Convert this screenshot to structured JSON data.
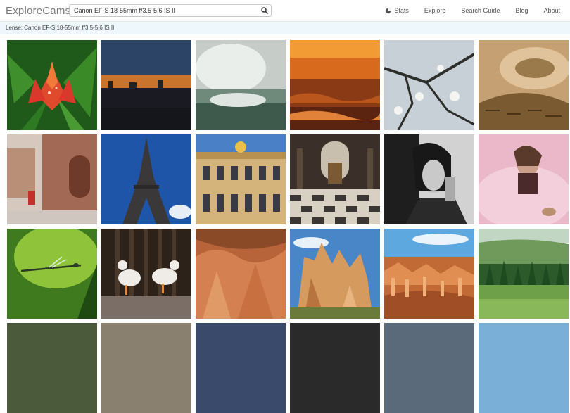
{
  "header": {
    "logo": "ExploreCams",
    "search_value": "Canon EF-S 18-55mm f/3.5-5.6 IS II",
    "nav": [
      {
        "label": "Stats",
        "icon": "pie-chart-icon"
      },
      {
        "label": "Explore"
      },
      {
        "label": "Search Guide"
      },
      {
        "label": "Blog"
      },
      {
        "label": "About"
      }
    ]
  },
  "lense_label": "Lense: Canon EF-S 18-55mm f/3.5-5.6 IS II",
  "photos": [
    {
      "subject": "red lily flower with dew drops",
      "colors": [
        "#2a7a22",
        "#e2462c"
      ]
    },
    {
      "subject": "city skyline at dusk over water",
      "colors": [
        "#2f4a6b",
        "#d1782e"
      ]
    },
    {
      "subject": "Niagara falls mist",
      "colors": [
        "#c7d0c9",
        "#5b7a6a"
      ]
    },
    {
      "subject": "orange sunset over ocean waves",
      "colors": [
        "#e8892b",
        "#6b2e12"
      ]
    },
    {
      "subject": "blossom branches against sky",
      "colors": [
        "#c9d3d8",
        "#343834"
      ]
    },
    {
      "subject": "crocodile leather close-up",
      "colors": [
        "#b99560",
        "#5b4424"
      ]
    },
    {
      "subject": "brick street with red postbox",
      "colors": [
        "#b18f7c",
        "#c23a2a"
      ]
    },
    {
      "subject": "Eiffel tower against blue sky",
      "colors": [
        "#1d4fa3",
        "#3b3a3a"
      ]
    },
    {
      "subject": "Palace of Versailles facade",
      "colors": [
        "#4d82c8",
        "#d6b77a"
      ]
    },
    {
      "subject": "church interior with checker floor",
      "colors": [
        "#3c332b",
        "#d9d2c4"
      ]
    },
    {
      "subject": "black and white portrait of woman",
      "colors": [
        "#cfcfcf",
        "#252525"
      ]
    },
    {
      "subject": "woman in pink tulle dress",
      "colors": [
        "#e9b6c8",
        "#6a3a3e"
      ]
    },
    {
      "subject": "damselfly on green stem",
      "colors": [
        "#8ec23a",
        "#1d4a12"
      ]
    },
    {
      "subject": "two white ducks by wooden fence",
      "colors": [
        "#3e2e22",
        "#e9e4df"
      ]
    },
    {
      "subject": "orange hoodoo rock canyon",
      "colors": [
        "#c56b3a",
        "#7a3e1f"
      ]
    },
    {
      "subject": "hoodoo spires under blue sky",
      "colors": [
        "#4a86c6",
        "#d1955a"
      ]
    },
    {
      "subject": "Bryce canyon amphitheater",
      "colors": [
        "#5ea7e0",
        "#c46a35"
      ]
    },
    {
      "subject": "green hills with trees",
      "colors": [
        "#5d8a4c",
        "#2e5a2a"
      ]
    }
  ],
  "colors": {
    "lense_bar_bg": "#eef7fb",
    "logo": "#7b7b7b"
  }
}
